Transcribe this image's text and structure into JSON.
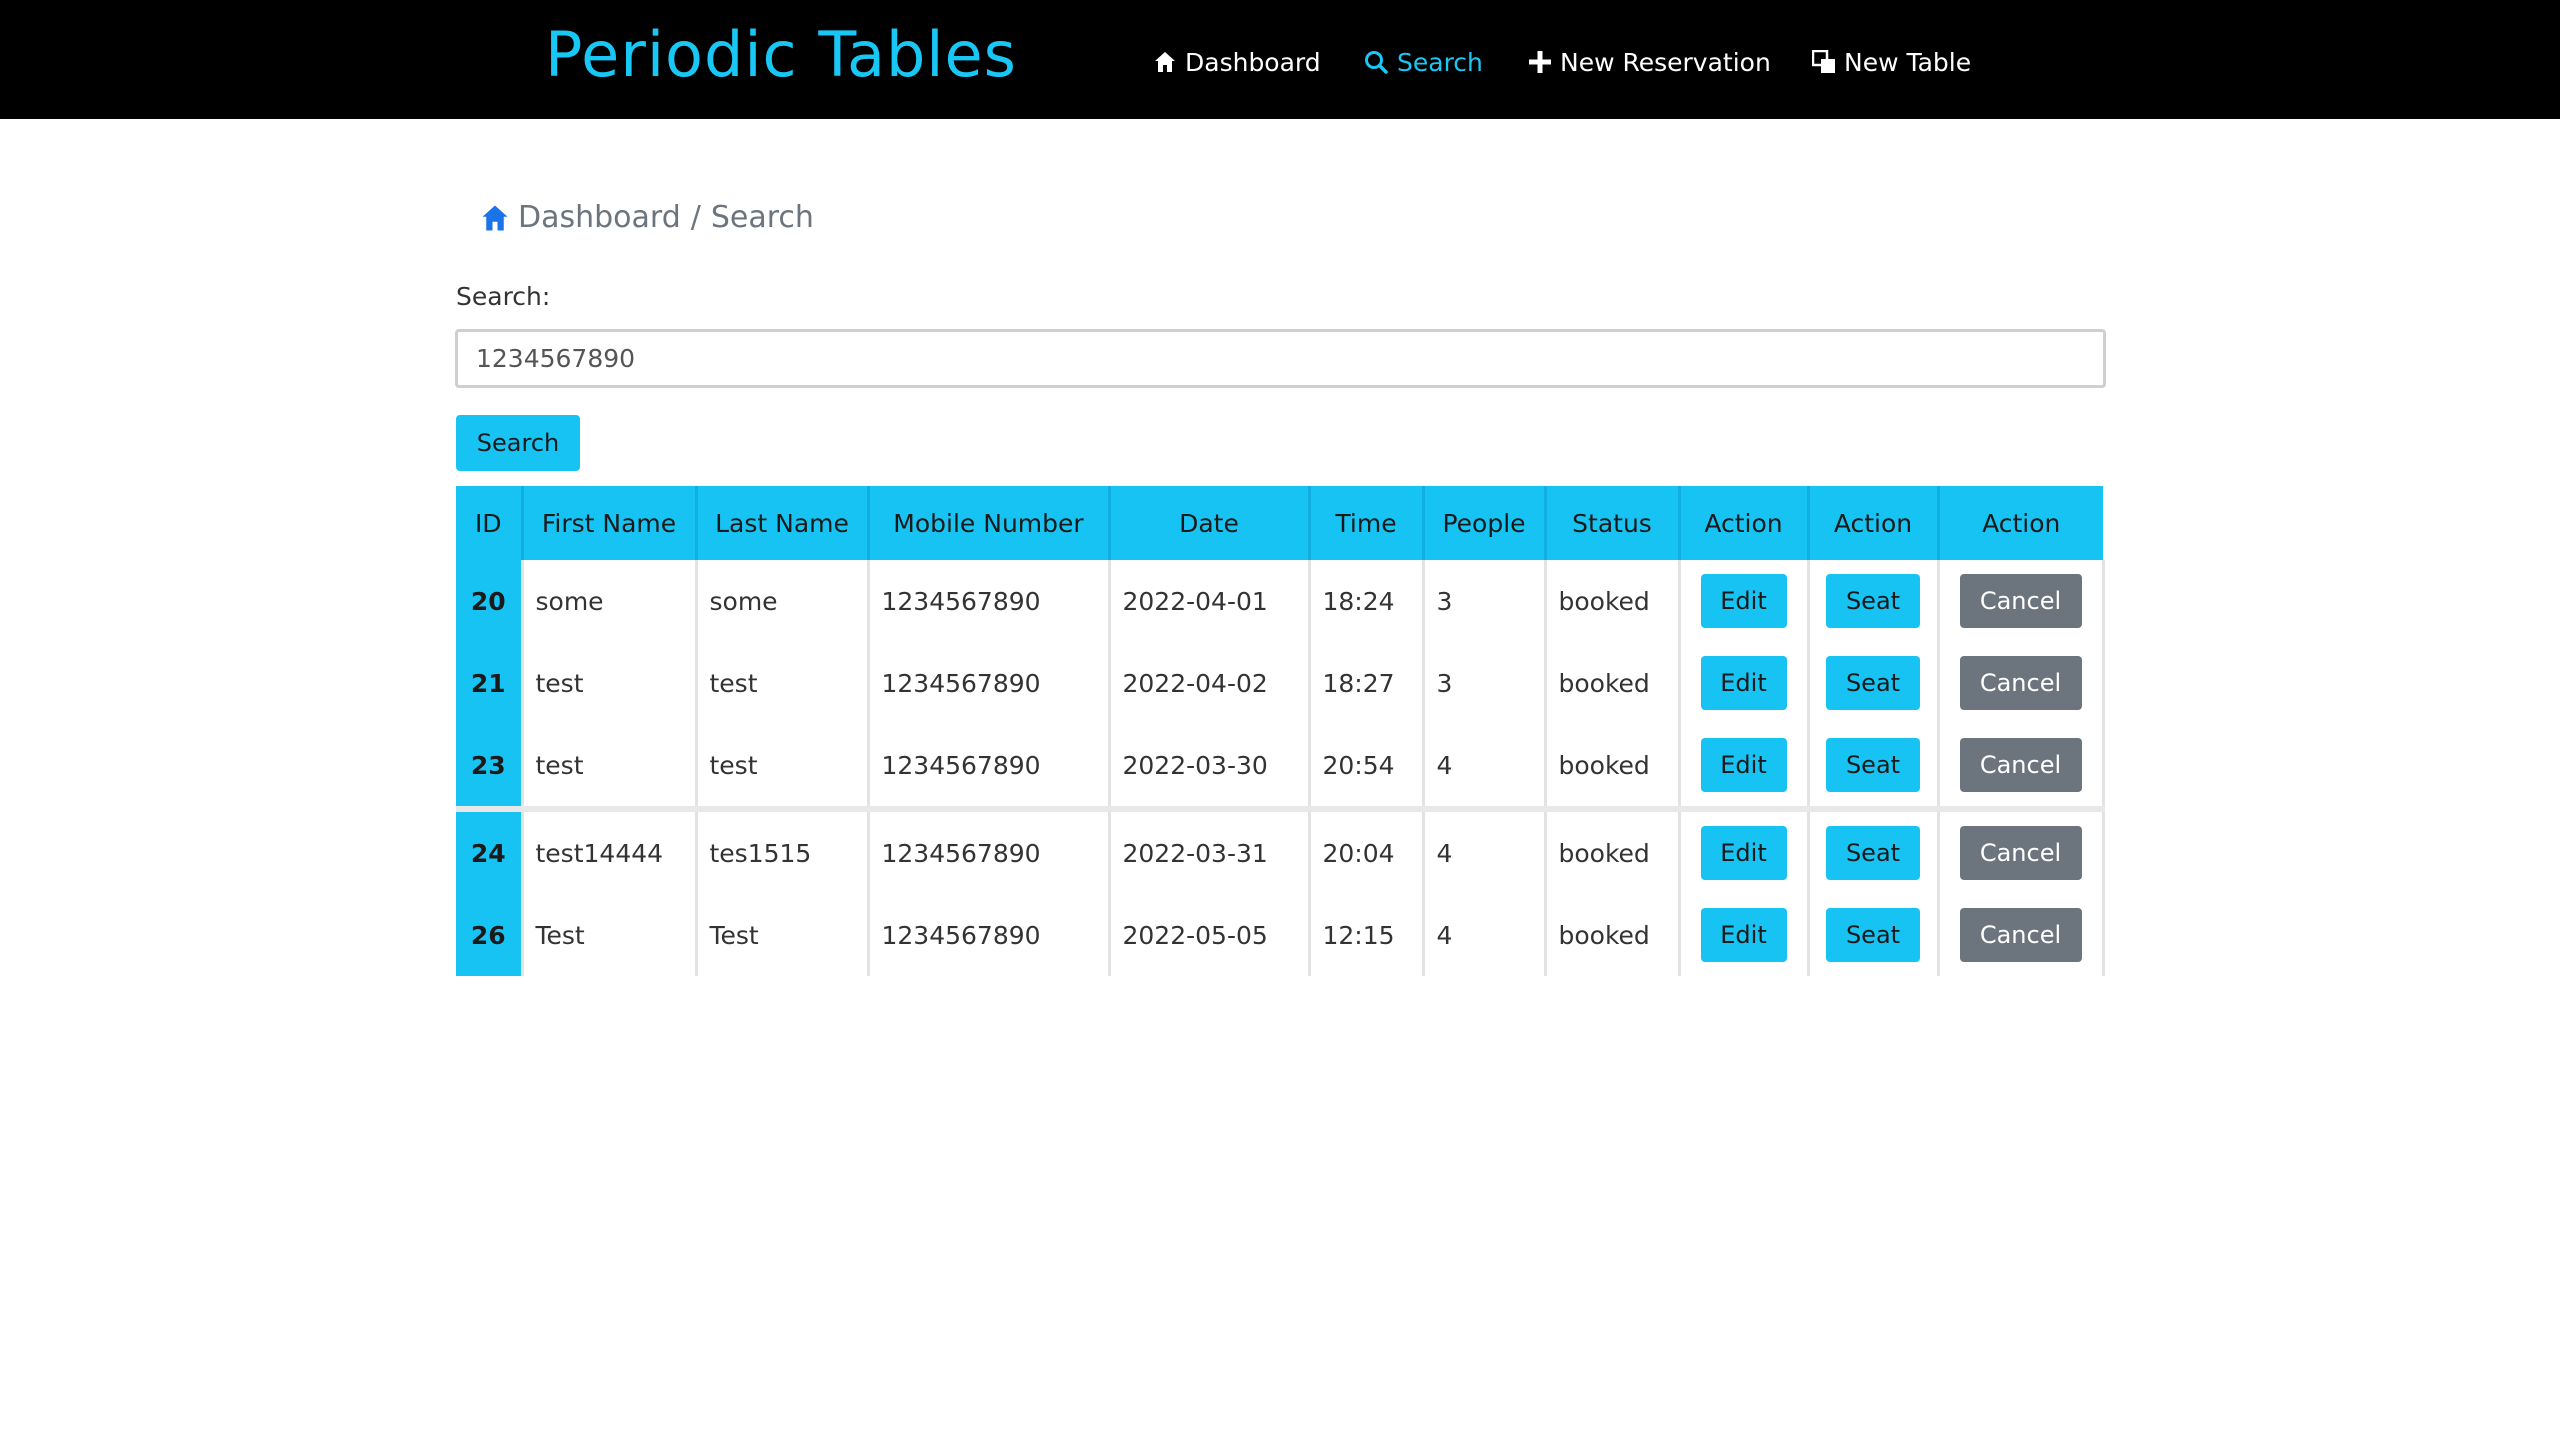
{
  "app": {
    "title": "Periodic Tables"
  },
  "colors": {
    "accent": "#17c3f3",
    "navbar": "#000000",
    "cancel": "#6c757d"
  },
  "nav": {
    "items": [
      {
        "label": "Dashboard",
        "icon": "home-icon"
      },
      {
        "label": "Search",
        "icon": "search-icon",
        "active": true
      },
      {
        "label": "New Reservation",
        "icon": "plus-icon"
      },
      {
        "label": "New Table",
        "icon": "table-icon"
      }
    ]
  },
  "breadcrumb": {
    "home": "Dashboard",
    "separator": "/",
    "current": "Search"
  },
  "search": {
    "label": "Search:",
    "value": "1234567890",
    "button": "Search"
  },
  "table": {
    "headers": [
      "ID",
      "First Name",
      "Last Name",
      "Mobile Number",
      "Date",
      "Time",
      "People",
      "Status",
      "Action",
      "Action",
      "Action"
    ],
    "buttons": {
      "edit": "Edit",
      "seat": "Seat",
      "cancel": "Cancel"
    },
    "rows": [
      {
        "id": "20",
        "first": "some",
        "last": "some",
        "mobile": "1234567890",
        "date": "2022-04-01",
        "time": "18:24",
        "people": "3",
        "status": "booked"
      },
      {
        "id": "21",
        "first": "test",
        "last": "test",
        "mobile": "1234567890",
        "date": "2022-04-02",
        "time": "18:27",
        "people": "3",
        "status": "booked"
      },
      {
        "id": "23",
        "first": "test",
        "last": "test",
        "mobile": "1234567890",
        "date": "2022-03-30",
        "time": "20:54",
        "people": "4",
        "status": "booked"
      },
      {
        "id": "24",
        "first": "test14444",
        "last": "tes1515",
        "mobile": "1234567890",
        "date": "2022-03-31",
        "time": "20:04",
        "people": "4",
        "status": "booked"
      },
      {
        "id": "26",
        "first": "Test",
        "last": "Test",
        "mobile": "1234567890",
        "date": "2022-05-05",
        "time": "12:15",
        "people": "4",
        "status": "booked"
      }
    ]
  }
}
